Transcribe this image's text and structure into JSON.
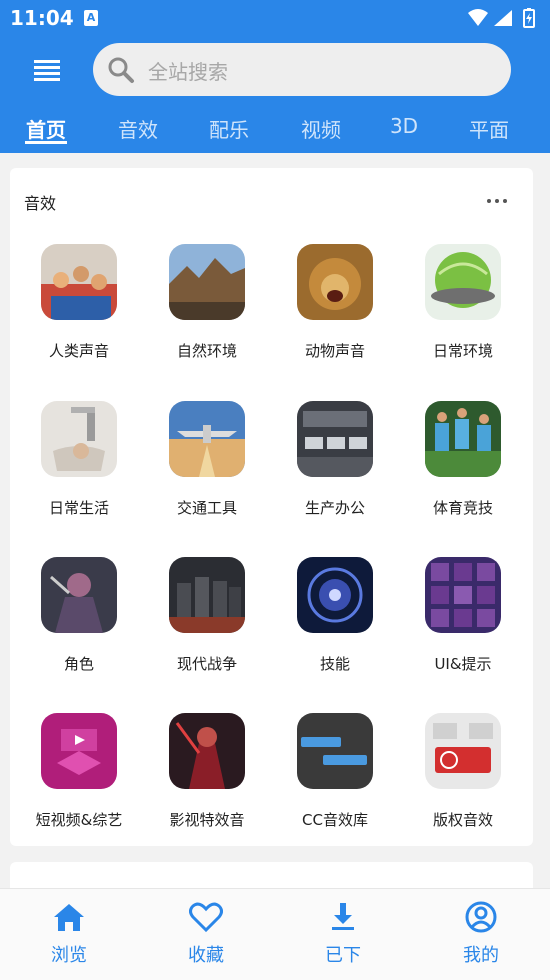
{
  "status_bar": {
    "time": "11:04",
    "notification_icon": "A"
  },
  "header": {
    "menu_icon": "menu-icon",
    "search_placeholder": "全站搜索",
    "tabs": [
      "首页",
      "音效",
      "配乐",
      "视频",
      "3D",
      "平面"
    ],
    "active_tab": "首页"
  },
  "section": {
    "title": "音效",
    "items": [
      {
        "label": "人类声音"
      },
      {
        "label": "自然环境"
      },
      {
        "label": "动物声音"
      },
      {
        "label": "日常环境"
      },
      {
        "label": "日常生活"
      },
      {
        "label": "交通工具"
      },
      {
        "label": "生产办公"
      },
      {
        "label": "体育竞技"
      },
      {
        "label": "角色"
      },
      {
        "label": "现代战争"
      },
      {
        "label": "技能"
      },
      {
        "label": "UI&提示"
      },
      {
        "label": "短视频&综艺"
      },
      {
        "label": "影视特效音"
      },
      {
        "label": "CC音效库"
      },
      {
        "label": "版权音效"
      }
    ]
  },
  "bottom_nav": [
    {
      "label": "浏览",
      "icon": "home-icon"
    },
    {
      "label": "收藏",
      "icon": "heart-icon"
    },
    {
      "label": "已下",
      "icon": "download-icon"
    },
    {
      "label": "我的",
      "icon": "user-icon"
    }
  ],
  "colors": {
    "accent": "#2a86e8"
  }
}
